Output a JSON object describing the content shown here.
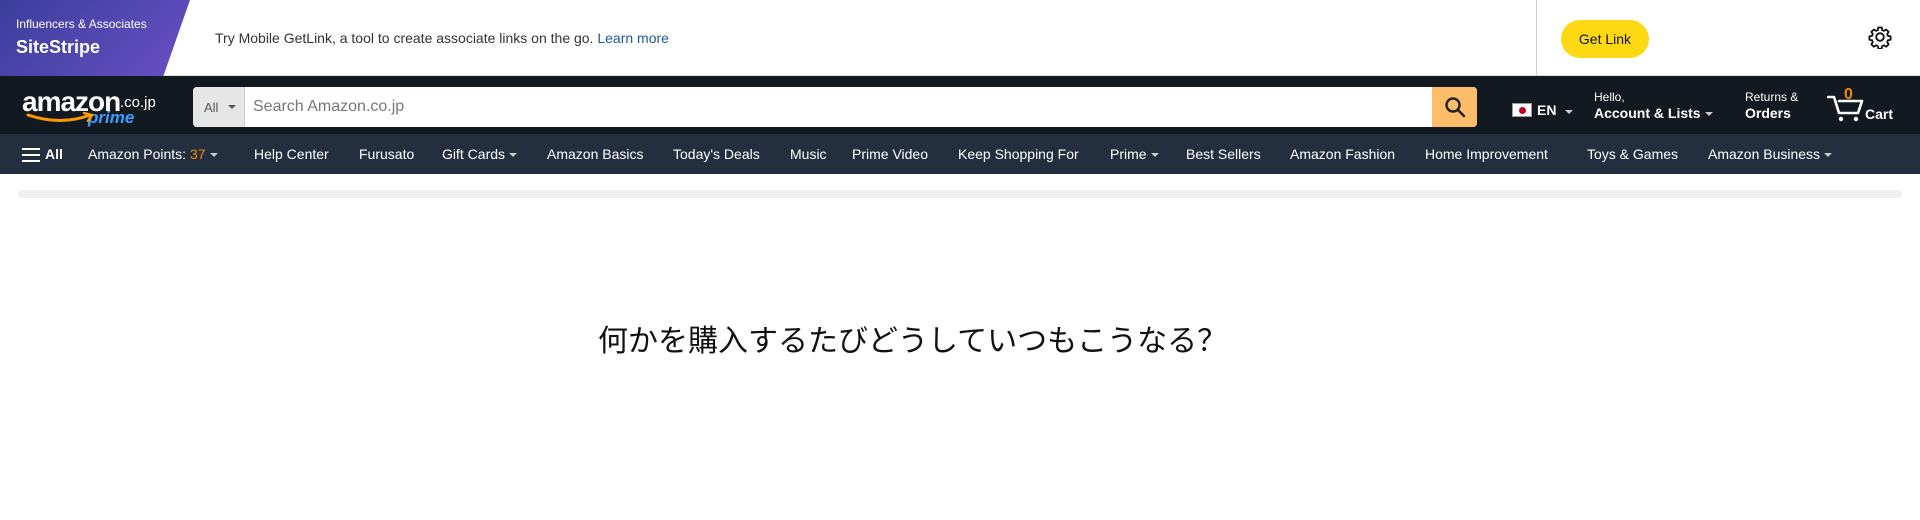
{
  "sitestripe": {
    "badge_small": "Influencers & Associates",
    "badge_title": "SiteStripe",
    "message": "Try Mobile GetLink, a tool to create associate links on the go.",
    "learn_more": "Learn more",
    "get_link": "Get Link",
    "settings_icon": "gear-icon"
  },
  "header": {
    "logo_word": "amazon",
    "logo_tld": ".co.jp",
    "logo_prime": "prime",
    "search_category": "All",
    "search_placeholder": "Search Amazon.co.jp",
    "language": "EN",
    "greeting": "Hello,",
    "account": "Account & Lists",
    "returns": "Returns &",
    "orders": "Orders",
    "cart_count": "0",
    "cart_label": "Cart"
  },
  "subnav": {
    "all": "All",
    "points_label": "Amazon Points:",
    "points_value": "37",
    "items": [
      "Help Center",
      "Furusato",
      "Gift Cards",
      "Amazon Basics",
      "Today's Deals",
      "Music",
      "Prime Video",
      "Keep Shopping For",
      "Prime",
      "Best Sellers",
      "Amazon Fashion",
      "Home Improvement",
      "Toys & Games",
      "Amazon Business"
    ]
  },
  "main": {
    "text": "何かを購入するたびどうしていつもこうなる？"
  },
  "colors": {
    "nav_dark": "#131921",
    "subnav": "#232f3e",
    "search_button": "#febd69",
    "get_link": "#ffd814",
    "accent_orange": "#f08804"
  }
}
